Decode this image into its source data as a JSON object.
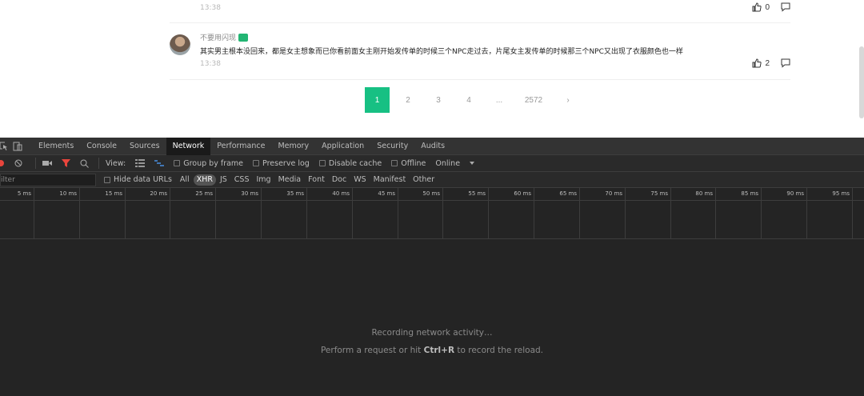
{
  "page": {
    "comment1": {
      "time": "13:38",
      "likes": "0"
    },
    "comment2": {
      "username": "不要用闪现",
      "text": "其实男主根本没回来，都是女主想象而已你看前面女主刚开始发传单的时候三个NPC走过去，片尾女主发传单的时候那三个NPC又出现了衣服颜色也一样",
      "time": "13:38",
      "likes": "2"
    },
    "pagination": {
      "pages": [
        "1",
        "2",
        "3",
        "4",
        "...",
        "2572",
        "›"
      ],
      "active": "1"
    }
  },
  "devtools": {
    "tabs": [
      "Elements",
      "Console",
      "Sources",
      "Network",
      "Performance",
      "Memory",
      "Application",
      "Security",
      "Audits"
    ],
    "active_tab": "Network",
    "toolbar": {
      "view_label": "View:",
      "group_by_frame": "Group by frame",
      "preserve_log": "Preserve log",
      "disable_cache": "Disable cache",
      "offline": "Offline",
      "throttle": "Online"
    },
    "filter": {
      "placeholder": "ilter",
      "hide_data_urls": "Hide data URLs",
      "types": [
        "All",
        "XHR",
        "JS",
        "CSS",
        "Img",
        "Media",
        "Font",
        "Doc",
        "WS",
        "Manifest",
        "Other"
      ],
      "active_type": "XHR"
    },
    "timeline_ticks": [
      "5 ms",
      "10 ms",
      "15 ms",
      "20 ms",
      "25 ms",
      "30 ms",
      "35 ms",
      "40 ms",
      "45 ms",
      "50 ms",
      "55 ms",
      "60 ms",
      "65 ms",
      "70 ms",
      "75 ms",
      "80 ms",
      "85 ms",
      "90 ms",
      "95 ms"
    ],
    "empty": {
      "recording": "Recording network activity…",
      "perform_prefix": "Perform a request or hit ",
      "shortcut": "Ctrl+R",
      "perform_suffix": " to record the reload."
    }
  }
}
